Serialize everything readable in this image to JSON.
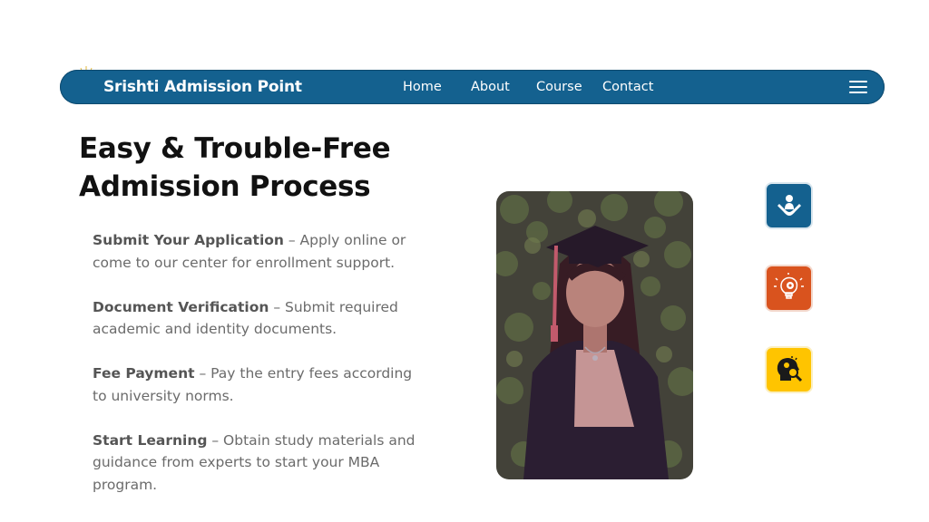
{
  "navbar": {
    "brand": "Srishti Admission Point",
    "links": [
      "Home",
      "About",
      "Course",
      "Contact"
    ]
  },
  "hero": {
    "headline": "Easy & Trouble-Free Admission Process",
    "steps": [
      {
        "title": "Submit Your Application",
        "text": " – Apply online or come to our center for enrollment support."
      },
      {
        "title": "Document Verification",
        "text": " – Submit required academic and identity documents."
      },
      {
        "title": "Fee Payment",
        "text": " – Pay the entry fees according to university norms."
      },
      {
        "title": "Start Learning",
        "text": " – Obtain study materials and guidance from experts to start your MBA program."
      }
    ]
  },
  "icons": {
    "features": [
      "hands-holding-person-icon",
      "lightbulb-gear-icon",
      "head-magnifier-icon"
    ]
  },
  "colors": {
    "brand_blue": "#14618f",
    "accent_orange": "#d9531e",
    "accent_yellow": "#ffc400"
  }
}
